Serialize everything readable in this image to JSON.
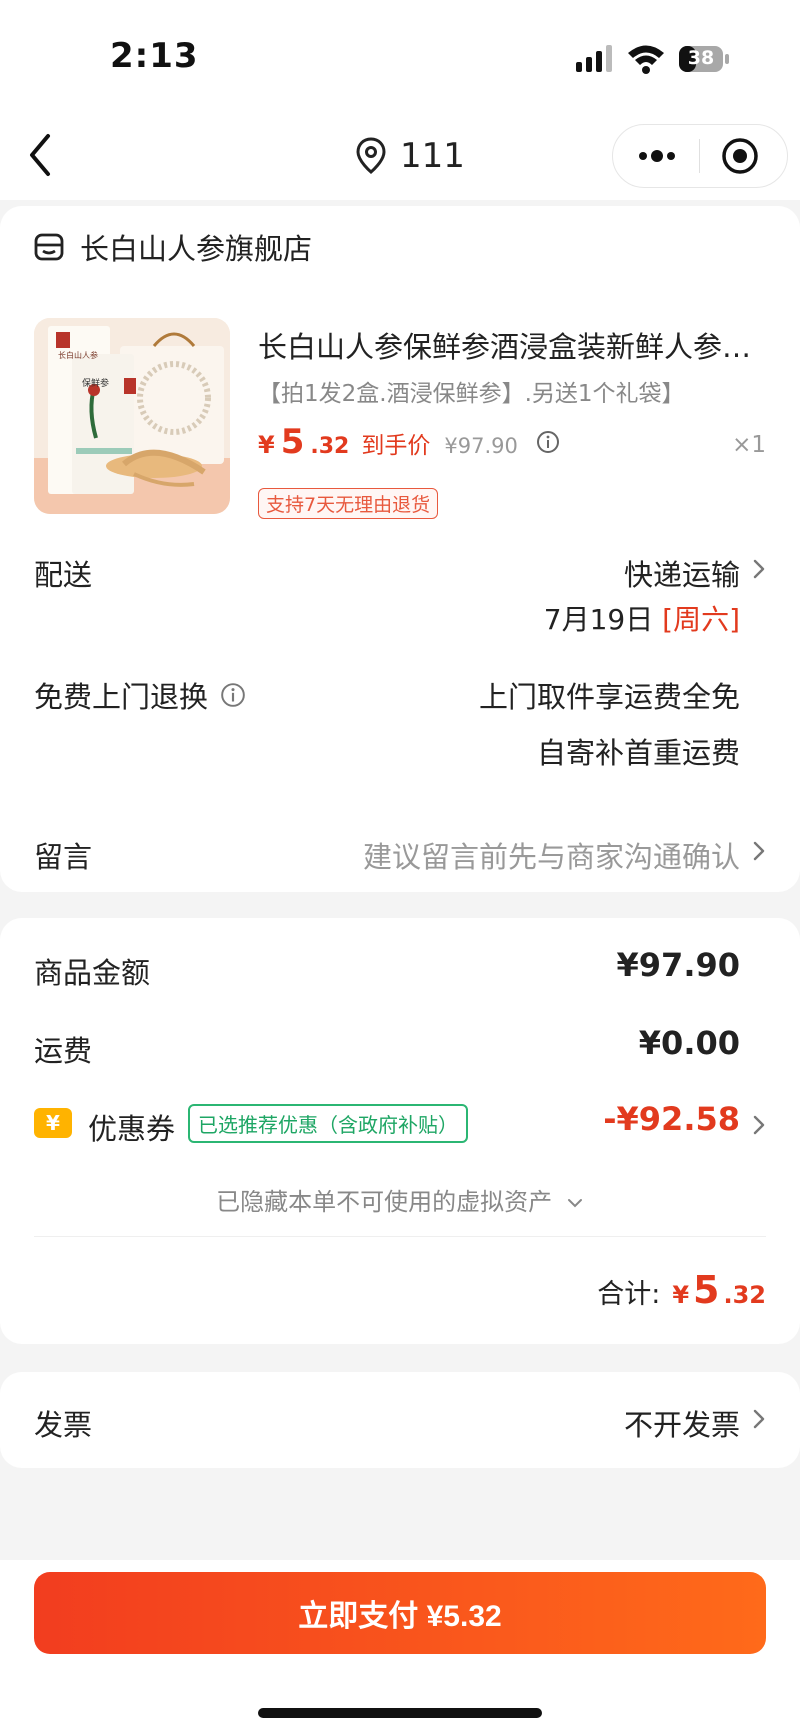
{
  "status_bar": {
    "time": "2:13",
    "battery": "38"
  },
  "nav": {
    "location": "111"
  },
  "shop": {
    "name": "长白山人参旗舰店",
    "product": {
      "title": "长白山人参保鲜参酒浸盒装新鲜人参…",
      "sku": "【拍1发2盒.酒浸保鲜参】.另送1个礼袋】",
      "price_symbol": "¥",
      "price_int": "5",
      "price_dec": ".32",
      "price_label": "到手价",
      "original_price": "¥97.90",
      "quantity": "×1",
      "refund_tag": "支持7天无理由退货",
      "package_brand": "长白山人参",
      "package_name": "保鲜参"
    },
    "delivery": {
      "label": "配送",
      "method": "快递运输",
      "date": "7月19日",
      "weekday": "[周六]"
    },
    "return": {
      "label": "免费上门退换",
      "line1": "上门取件享运费全免",
      "line2": "自寄补首重运费"
    },
    "message": {
      "label": "留言",
      "hint": "建议留言前先与商家沟通确认"
    }
  },
  "summary": {
    "goods_label": "商品金额",
    "goods_value": "¥97.90",
    "shipping_label": "运费",
    "shipping_value": "¥0.00",
    "coupon_icon_text": "¥",
    "coupon_label": "优惠券",
    "coupon_tag": "已选推荐优惠（含政府补贴）",
    "coupon_value": "-¥92.58",
    "hidden_tip": "已隐藏本单不可使用的虚拟资产",
    "total_label": "合计:",
    "total_symbol": "¥",
    "total_int": "5",
    "total_dec": ".32"
  },
  "invoice": {
    "label": "发票",
    "value": "不开发票"
  },
  "pay": {
    "button_label": "立即支付 ¥5.32"
  },
  "colors": {
    "accent": "#e23a1e",
    "coupon_green": "#1ea664",
    "button_start": "#f23d1f",
    "button_end": "#ff6a1a"
  }
}
